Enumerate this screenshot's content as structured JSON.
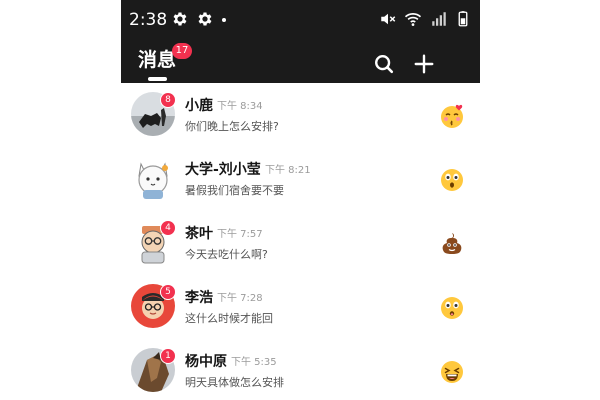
{
  "status_bar": {
    "time": "2:38",
    "icons": [
      "gear-icon",
      "gear-icon",
      "mute-icon",
      "wifi-icon",
      "signal-icon",
      "battery-icon"
    ]
  },
  "header": {
    "title": "消息",
    "unread_badge": "17",
    "buttons": [
      "search-icon",
      "plus-icon"
    ]
  },
  "conversations": [
    {
      "name": "小鹿",
      "time": "下午 8:34",
      "message": "你们晚上怎么安排?",
      "badge": "8",
      "emoji": "kiss-face-icon"
    },
    {
      "name": "大学-刘小莹",
      "time": "下午 8:21",
      "message": "暑假我们宿舍要不要",
      "badge": "",
      "emoji": "surprised-face-icon"
    },
    {
      "name": "茶叶",
      "time": "下午 7:57",
      "message": "今天去吃什么啊?",
      "badge": "4",
      "emoji": "poop-icon"
    },
    {
      "name": "李浩",
      "time": "下午 7:28",
      "message": "这什么时候才能回",
      "badge": "5",
      "emoji": "astonished-face-icon"
    },
    {
      "name": "杨中原",
      "time": "下午 5:35",
      "message": "明天具体做怎么安排",
      "badge": "1",
      "emoji": "laughing-face-icon"
    }
  ],
  "colors": {
    "header_bg": "#1b1b1b",
    "badge": "#f2314f",
    "emoji_yellow": "#ffc83d"
  }
}
